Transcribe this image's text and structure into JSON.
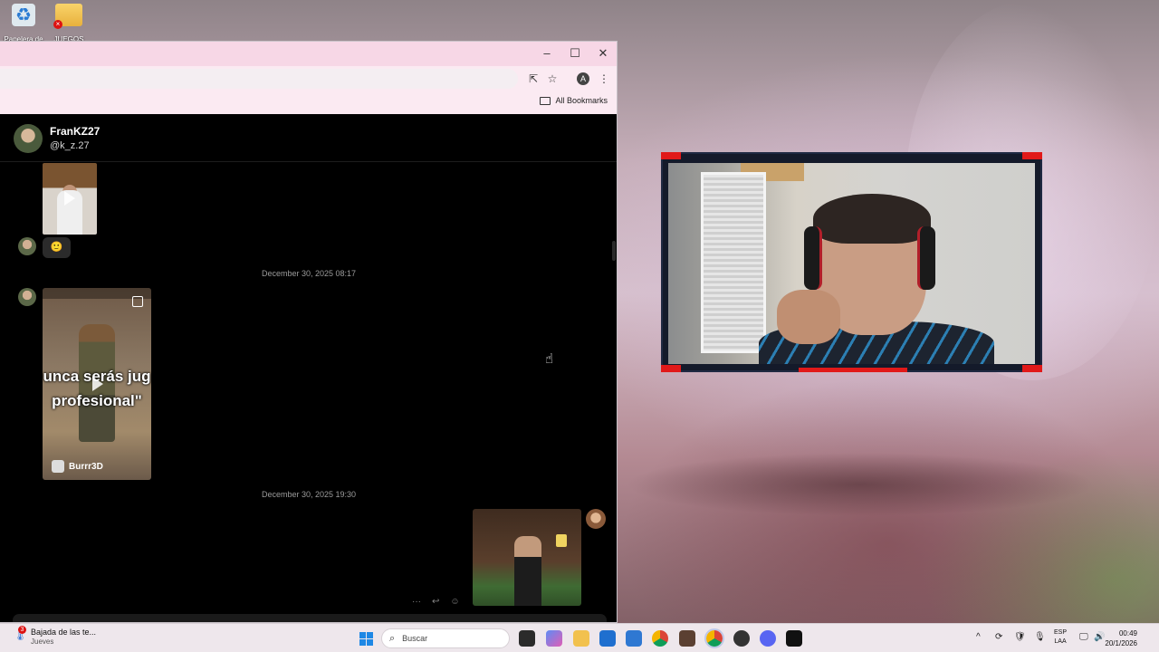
{
  "desktop": {
    "icons": [
      {
        "label": "Papelera de",
        "icon": "recycle-bin-icon"
      },
      {
        "label": "JUEGOS",
        "icon": "folder-icon"
      }
    ]
  },
  "browser": {
    "window_controls": {
      "minimize": "–",
      "maximize": "☐",
      "close": "✕"
    },
    "profile_initial": "A",
    "bookmarks_label": "All Bookmarks"
  },
  "chat": {
    "contact": {
      "name": "FranKZ27",
      "handle": "@k_z.27"
    },
    "reaction_emoji": "🙂",
    "separators": [
      "December 30, 2025 08:17",
      "December 30, 2025 19:30"
    ],
    "video_caption": [
      "unca serás jug",
      "profesional\""
    ],
    "video_author": "Burrr3D",
    "message_actions": [
      "···",
      "↩",
      "☺"
    ]
  },
  "taskbar": {
    "weather_title": "Bajada de las te...",
    "weather_sub": "Jueves",
    "weather_badge": "3",
    "search_placeholder": "Buscar",
    "lang_line1": "ESP",
    "lang_line2": "LAA",
    "time": "00:49",
    "date": "20/1/2026",
    "tray_icons": [
      "^",
      "⟳",
      "🛡",
      "🎙",
      "🖵",
      "🔊",
      "🔋"
    ]
  },
  "colors": {
    "accent_red": "#e11919",
    "titlebar": "#f7d7e6",
    "chat_bg": "#000000"
  }
}
